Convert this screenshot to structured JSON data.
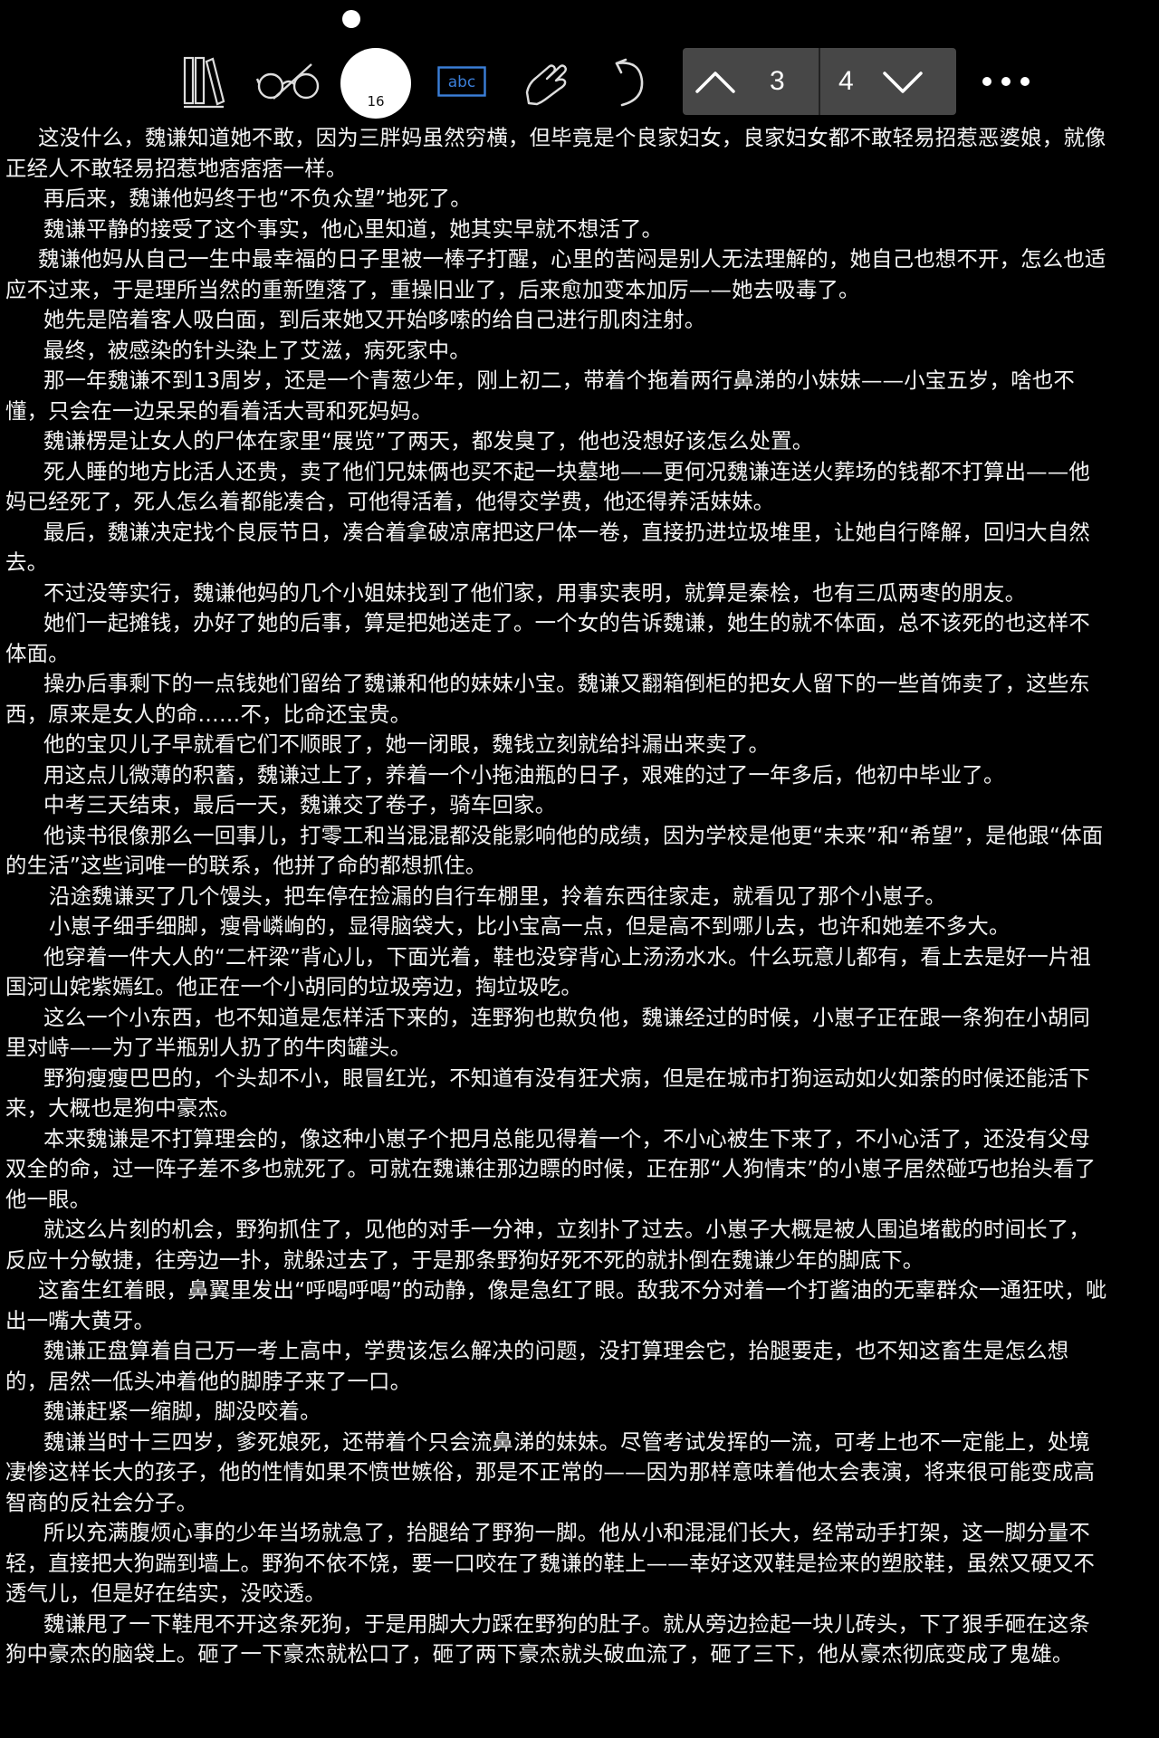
{
  "toolbar": {
    "font_size": "16",
    "abc_label": "abc",
    "page_prev": "3",
    "page_next": "4"
  },
  "paragraphs": [
    "这没什么，魏谦知道她不敢，因为三胖妈虽然穷横，但毕竟是个良家妇女，良家妇女都不敢轻易招惹恶婆娘，就像正经人不敢轻易招惹地痞痞痞一样。",
    "再后来，魏谦他妈终于也“不负众望”地死了。",
    "魏谦平静的接受了这个事实，他心里知道，她其实早就不想活了。",
    "魏谦他妈从自己一生中最幸福的日子里被一棒子打醒，心里的苦闷是别人无法理解的，她自己也想不开，怎么也适应不过来，于是理所当然的重新堕落了，重操旧业了，后来愈加变本加厉——她去吸毒了。",
    "她先是陪着客人吸白面，到后来她又开始哆嗦的给自己进行肌肉注射。",
    "最终，被感染的针头染上了艾滋，病死家中。",
    "那一年魏谦不到13周岁，还是一个青葱少年，刚上初二，带着个拖着两行鼻涕的小妹妹——小宝五岁，啥也不懂，只会在一边呆呆的看着活大哥和死妈妈。",
    "魏谦楞是让女人的尸体在家里“展览”了两天，都发臭了，他也没想好该怎么处置。",
    "死人睡的地方比活人还贵，卖了他们兄妹俩也买不起一块墓地——更何况魏谦连送火葬场的钱都不打算出——他妈已经死了，死人怎么着都能凑合，可他得活着，他得交学费，他还得养活妹妹。",
    "最后，魏谦决定找个良辰节日，凑合着拿破凉席把这尸体一卷，直接扔进垃圾堆里，让她自行降解，回归大自然去。",
    "不过没等实行，魏谦他妈的几个小姐妹找到了他们家，用事实表明，就算是秦桧，也有三瓜两枣的朋友。",
    "她们一起摊钱，办好了她的后事，算是把她送走了。一个女的告诉魏谦，她生的就不体面，总不该死的也这样不体面。",
    "操办后事剩下的一点钱她们留给了魏谦和他的妹妹小宝。魏谦又翻箱倒柜的把女人留下的一些首饰卖了，这些东西，原来是女人的命……不，比命还宝贵。",
    "他的宝贝儿子早就看它们不顺眼了，她一闭眼，魏钱立刻就给抖漏出来卖了。",
    "用这点儿微薄的积蓄，魏谦过上了，养着一个小拖油瓶的日子，艰难的过了一年多后，他初中毕业了。",
    "中考三天结束，最后一天，魏谦交了卷子，骑车回家。",
    "他读书很像那么一回事儿，打零工和当混混都没能影响他的成绩，因为学校是他更“未来”和“希望”，是他跟“体面的生活”这些词唯一的联系，他拼了命的都想抓住。",
    "沿途魏谦买了几个馒头，把车停在捡漏的自行车棚里，拎着东西往家走，就看见了那个小崽子。",
    "小崽子细手细脚，瘦骨嶙峋的，显得脑袋大，比小宝高一点，但是高不到哪儿去，也许和她差不多大。",
    "他穿着一件大人的“二杆梁”背心儿，下面光着，鞋也没穿背心上汤汤水水。什么玩意儿都有，看上去是好一片祖国河山姹紫嫣红。他正在一个小胡同的垃圾旁边，掏垃圾吃。",
    "这么一个小东西，也不知道是怎样活下来的，连野狗也欺负他，魏谦经过的时候，小崽子正在跟一条狗在小胡同里对峙——为了半瓶别人扔了的牛肉罐头。",
    "野狗瘦瘦巴巴的，个头却不小，眼冒红光，不知道有没有狂犬病，但是在城市打狗运动如火如荼的时候还能活下来，大概也是狗中豪杰。",
    "本来魏谦是不打算理会的，像这种小崽子个把月总能见得着一个，不小心被生下来了，不小心活了，还没有父母双全的命，过一阵子差不多也就死了。可就在魏谦往那边瞟的时候，正在那“人狗情末”的小崽子居然碰巧也抬头看了他一眼。",
    "就这么片刻的机会，野狗抓住了，见他的对手一分神，立刻扑了过去。小崽子大概是被人围追堵截的时间长了，反应十分敏捷，往旁边一扑，就躲过去了，于是那条野狗好死不死的就扑倒在魏谦少年的脚底下。",
    "这畜生红着眼，鼻翼里发出“呼喝呼喝”的动静，像是急红了眼。敌我不分对着一个打酱油的无辜群众一通狂吠，呲出一嘴大黄牙。",
    "魏谦正盘算着自己万一考上高中，学费该怎么解决的问题，没打算理会它，抬腿要走，也不知这畜生是怎么想的，居然一低头冲着他的脚脖子来了一口。",
    "魏谦赶紧一缩脚，脚没咬着。",
    "魏谦当时十三四岁，爹死娘死，还带着个只会流鼻涕的妹妹。尽管考试发挥的一流，可考上也不一定能上，处境凄惨这样长大的孩子，他的性情如果不愤世嫉俗，那是不正常的——因为那样意味着他太会表演，将来很可能变成高智商的反社会分子。",
    "所以充满腹烦心事的少年当场就急了，抬腿给了野狗一脚。他从小和混混们长大，经常动手打架，这一脚分量不轻，直接把大狗踹到墙上。野狗不依不饶，要一口咬在了魏谦的鞋上——幸好这双鞋是捡来的塑胶鞋，虽然又硬又不透气儿，但是好在结实，没咬透。",
    "魏谦甩了一下鞋甩不开这条死狗，于是用脚大力踩在野狗的肚子。就从旁边捡起一块儿砖头，下了狠手砸在这条狗中豪杰的脑袋上。砸了一下豪杰就松口了，砸了两下豪杰就头破血流了，砸了三下，他从豪杰彻底变成了鬼雄。"
  ]
}
